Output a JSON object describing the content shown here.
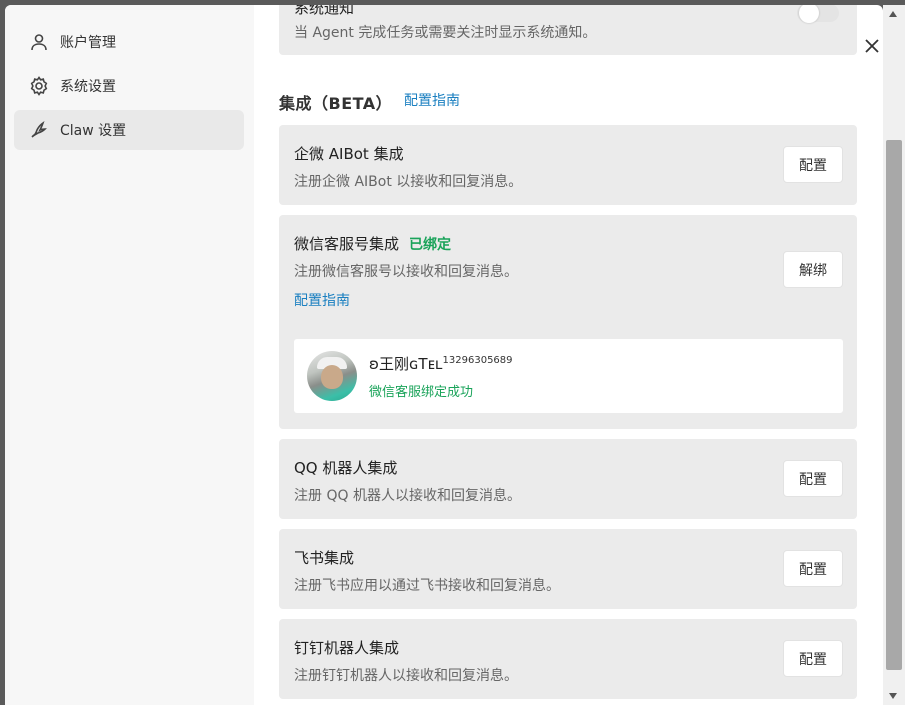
{
  "sidebar": {
    "items": [
      {
        "label": "账户管理",
        "icon": "user-icon"
      },
      {
        "label": "系统设置",
        "icon": "gear-icon"
      },
      {
        "label": "Claw 设置",
        "icon": "claw-icon"
      }
    ],
    "active_index": 2
  },
  "notification": {
    "title": "系统通知",
    "desc": "当 Agent 完成任务或需要关注时显示系统通知。",
    "enabled": false
  },
  "integrations": {
    "section_title": "集成（BETA）",
    "guide_label": "配置指南",
    "wecom": {
      "title": "企微 AIBot 集成",
      "desc": "注册企微 AIBot 以接收和回复消息。",
      "button": "配置"
    },
    "wechat_service": {
      "title": "微信客服号集成",
      "badge": "已绑定",
      "desc": "注册微信客服号以接收和回复消息。",
      "guide": "配置指南",
      "button": "解绑",
      "user": {
        "name": "ʚ王刚ɢTᴇʟ",
        "phone": "13296305689",
        "status": "微信客服绑定成功"
      }
    },
    "qq": {
      "title": "QQ 机器人集成",
      "desc": "注册 QQ 机器人以接收和回复消息。",
      "button": "配置"
    },
    "feishu": {
      "title": "飞书集成",
      "desc": "注册飞书应用以通过飞书接收和回复消息。",
      "button": "配置"
    },
    "dingtalk": {
      "title": "钉钉机器人集成",
      "desc": "注册钉钉机器人以接收和回复消息。",
      "button": "配置"
    }
  },
  "colors": {
    "accent_link": "#1a7fc0",
    "success": "#1aa35a",
    "card_bg": "#ebebeb"
  }
}
